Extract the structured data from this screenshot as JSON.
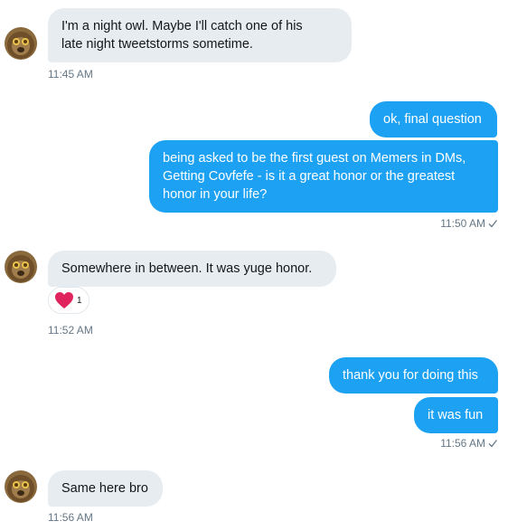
{
  "messages": [
    {
      "text": "I'm a night owl.  Maybe I'll catch one of his\nlate night tweetstorms sometime."
    },
    {
      "text": "ok, final question"
    },
    {
      "text": "being asked to be the first guest on Memers in DMs,\nGetting Covfefe - is it a great honor or the greatest\nhonor in your life?"
    },
    {
      "text": "Somewhere in between.   It was yuge honor."
    },
    {
      "text": "thank you for doing this"
    },
    {
      "text": "it was fun"
    },
    {
      "text": "Same here bro"
    }
  ],
  "timestamps": [
    "11:45 AM",
    "11:50 AM",
    "11:52 AM",
    "11:56 AM",
    "11:56 AM"
  ],
  "reaction": {
    "emoji": "heart-icon",
    "count": "1",
    "color": "#e0245e"
  },
  "colors": {
    "outgoing": "#1da1f2",
    "incoming": "#e6ecf0",
    "meta": "#657786"
  }
}
